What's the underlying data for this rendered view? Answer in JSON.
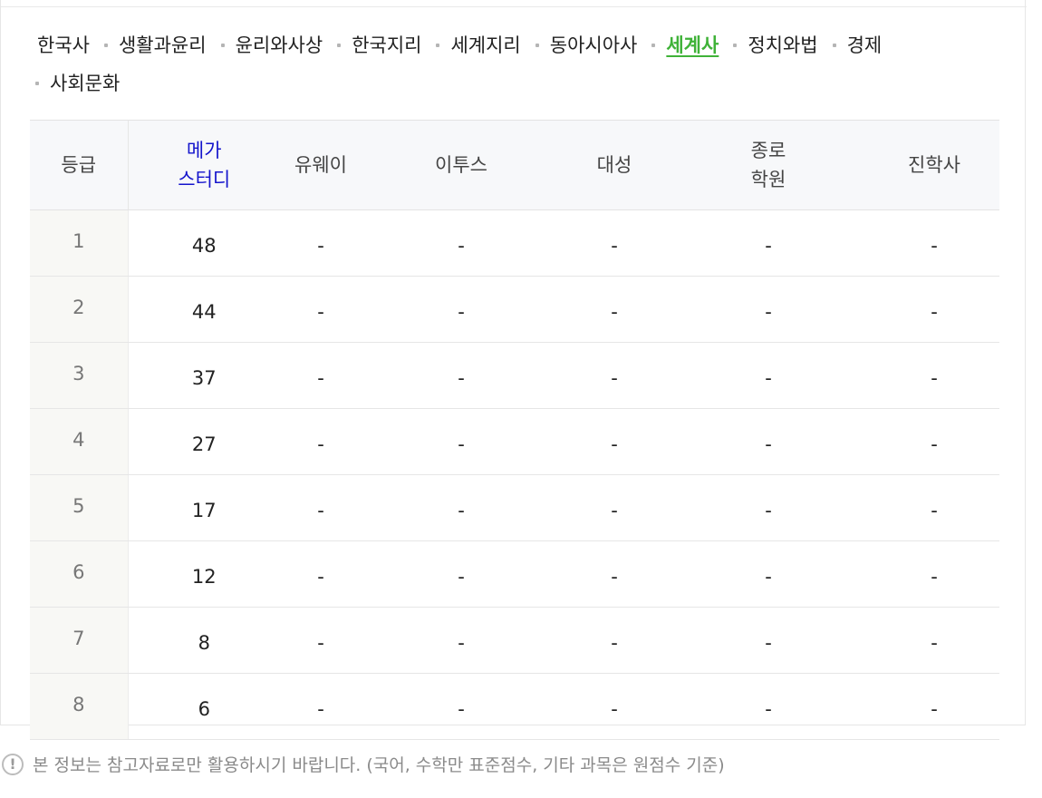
{
  "subjects": [
    {
      "label": "한국사"
    },
    {
      "label": "생활과윤리"
    },
    {
      "label": "윤리와사상"
    },
    {
      "label": "한국지리"
    },
    {
      "label": "세계지리"
    },
    {
      "label": "동아시아사"
    },
    {
      "label": "세계사",
      "active": true
    },
    {
      "label": "정치와법"
    },
    {
      "label": "경제"
    },
    {
      "label": "사회문화"
    }
  ],
  "table": {
    "headers": {
      "grade": "등급",
      "mega_line1": "메가",
      "mega_line2": "스터디",
      "uway": "유웨이",
      "etoos": "이투스",
      "daesung": "대성",
      "jongro_line1": "종로",
      "jongro_line2": "학원",
      "jinhak": "진학사"
    },
    "rows": [
      {
        "grade": "1",
        "mega": "48",
        "uway": "-",
        "etoos": "-",
        "daesung": "-",
        "jongro": "-",
        "jinhak": "-"
      },
      {
        "grade": "2",
        "mega": "44",
        "uway": "-",
        "etoos": "-",
        "daesung": "-",
        "jongro": "-",
        "jinhak": "-"
      },
      {
        "grade": "3",
        "mega": "37",
        "uway": "-",
        "etoos": "-",
        "daesung": "-",
        "jongro": "-",
        "jinhak": "-"
      },
      {
        "grade": "4",
        "mega": "27",
        "uway": "-",
        "etoos": "-",
        "daesung": "-",
        "jongro": "-",
        "jinhak": "-"
      },
      {
        "grade": "5",
        "mega": "17",
        "uway": "-",
        "etoos": "-",
        "daesung": "-",
        "jongro": "-",
        "jinhak": "-"
      },
      {
        "grade": "6",
        "mega": "12",
        "uway": "-",
        "etoos": "-",
        "daesung": "-",
        "jongro": "-",
        "jinhak": "-"
      },
      {
        "grade": "7",
        "mega": "8",
        "uway": "-",
        "etoos": "-",
        "daesung": "-",
        "jongro": "-",
        "jinhak": "-"
      },
      {
        "grade": "8",
        "mega": "6",
        "uway": "-",
        "etoos": "-",
        "daesung": "-",
        "jongro": "-",
        "jinhak": "-"
      }
    ]
  },
  "note": {
    "icon": "exclamation-circle-icon",
    "icon_glyph": "!",
    "text": "본 정보는 참고자료로만 활용하시기 바랍니다. (국어, 수학만 표준점수, 기타 과목은 원점수 기준)"
  },
  "colors": {
    "active_tab": "#3fb238",
    "mega_header": "#1414cc",
    "header_bg": "#f7f8fa",
    "grade_col_bg": "#f8f8f5"
  }
}
